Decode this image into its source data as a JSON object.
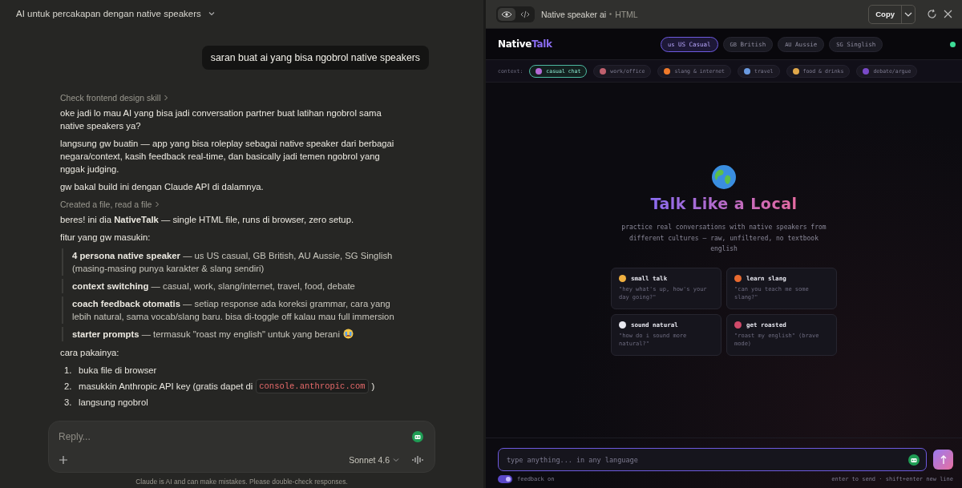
{
  "conversation": {
    "title": "AI untuk percakapan dengan native speakers"
  },
  "user_message": "saran buat ai yang bisa ngobrol native speakers",
  "response": [
    {
      "kind": "step",
      "text": "Check frontend design skill"
    },
    {
      "kind": "para",
      "text": "oke jadi lo mau AI yang bisa jadi conversation partner buat latihan ngobrol sama native speakers ya?"
    },
    {
      "kind": "para",
      "text": "langsung gw buatin — app yang bisa roleplay sebagai native speaker dari berbagai negara/context, kasih feedback real-time, dan basically jadi temen ngobrol yang nggak judging."
    },
    {
      "kind": "para",
      "text": "gw bakal build ini dengan Claude API di dalamnya."
    },
    {
      "kind": "step",
      "text": "Created a file, read a file"
    },
    {
      "kind": "para",
      "text": "beres! ini dia **NativeTalk** — single HTML file, runs di browser, zero setup."
    },
    {
      "kind": "para",
      "text": "fitur yang gw masukin:"
    },
    {
      "kind": "quote",
      "items": [
        {
          "text": "**4 persona native speaker** — us US casual, GB British, AU Aussie, SG Singlish (masing-masing punya karakter & slang sendiri)",
          "emoji": false
        },
        {
          "text": "**context switching** — casual, work, slang/internet, travel, food, debate",
          "emoji": false
        },
        {
          "text": "**coach feedback otomatis** — setiap response ada koreksi grammar, cara yang lebih natural, sama vocab/slang baru. bisa di-toggle off kalau mau full immersion",
          "emoji": false
        },
        {
          "text": "**starter prompts** — termasuk \"roast my english\" untuk yang berani",
          "emoji": true
        }
      ]
    },
    {
      "kind": "para",
      "text": "cara pakainya:"
    },
    {
      "kind": "ordered",
      "items": [
        {
          "num": "1.",
          "text": "buka file di browser"
        },
        {
          "num": "2.",
          "text": "masukkin Anthropic API key (gratis dapet di",
          "code": "console.anthropic.com",
          "after": ")"
        },
        {
          "num": "3.",
          "text": "langsung ngobrol"
        }
      ]
    }
  ],
  "composer": {
    "placeholder": "Reply...",
    "model": "Sonnet 4.6"
  },
  "disclaimer": "Claude is AI and can make mistakes. Please double-check responses.",
  "artifact": {
    "title": "Native speaker ai",
    "type": "HTML",
    "copy": "Copy",
    "views": [
      {
        "kind": "preview",
        "selected": true
      },
      {
        "kind": "code",
        "selected": false
      }
    ]
  },
  "app": {
    "logo": {
      "first": "Native",
      "second": "Talk"
    },
    "personas": [
      {
        "code": "us",
        "label": "US Casual",
        "selected": true
      },
      {
        "code": "GB",
        "label": "British",
        "selected": false
      },
      {
        "code": "AU",
        "label": "Aussie",
        "selected": false
      },
      {
        "code": "SG",
        "label": "Singlish",
        "selected": false
      }
    ],
    "context_label": "context:",
    "contexts": [
      {
        "label": "casual chat",
        "selected": true,
        "color": "#b46ad6"
      },
      {
        "label": "work/office",
        "selected": false,
        "color": "#c0606e"
      },
      {
        "label": "slang & internet",
        "selected": false,
        "color": "#f07a2a"
      },
      {
        "label": "travel",
        "selected": false,
        "color": "#6a9ae0"
      },
      {
        "label": "food & drinks",
        "selected": false,
        "color": "#e0a84a"
      },
      {
        "label": "debate/argue",
        "selected": false,
        "color": "#7a4ac8"
      }
    ],
    "hero": {
      "title": "Talk Like a Local",
      "subtitle": "practice real conversations with native speakers from different cultures — raw, unfiltered, no textbook english"
    },
    "starters": [
      {
        "title": "small talk",
        "prompt": "\"hey what's up, how's your day going?\"",
        "color": "#f0b040"
      },
      {
        "title": "learn slang",
        "prompt": "\"can you teach me some slang?\"",
        "color": "#e86a30"
      },
      {
        "title": "sound natural",
        "prompt": "\"how do i sound more natural?\"",
        "color": "#e8e8f0"
      },
      {
        "title": "get roasted",
        "prompt": "\"roast my english\" (brave mode)",
        "color": "#d04a6a"
      }
    ],
    "input": {
      "placeholder": "type anything... in any language"
    },
    "feedback": {
      "label": "feedback on",
      "on": true
    },
    "hint": "enter to send · shift+enter new line"
  }
}
